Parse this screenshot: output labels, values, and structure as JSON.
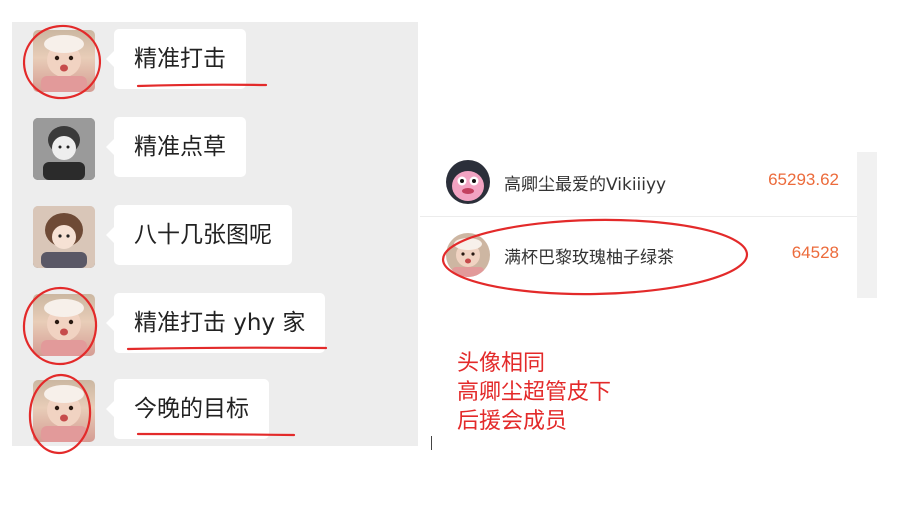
{
  "chat": {
    "messages": [
      {
        "avatar": "baby-avatar",
        "text": "精准打击"
      },
      {
        "avatar": "girl-avatar",
        "text": "精准点草"
      },
      {
        "avatar": "girl-avatar",
        "text": "八十几张图呢"
      },
      {
        "avatar": "baby-avatar",
        "text": "精准打击 yhy 家"
      },
      {
        "avatar": "baby-avatar",
        "text": "今晚的目标"
      }
    ]
  },
  "ranking": {
    "rows": [
      {
        "name": "高卿尘最爱的Vikiiiyy",
        "score": "65293.62",
        "avatar": "pink-monster-avatar"
      },
      {
        "name": "满杯巴黎玫瑰柚子绿茶",
        "score": "64528",
        "avatar": "baby-avatar"
      }
    ]
  },
  "annotation": {
    "lines": [
      "头像相同",
      "高卿尘超管皮下",
      "后援会成员"
    ]
  },
  "colors": {
    "accent_red": "#e32a2a",
    "score_orange": "#ec6b3b",
    "chat_background": "#ededed"
  }
}
